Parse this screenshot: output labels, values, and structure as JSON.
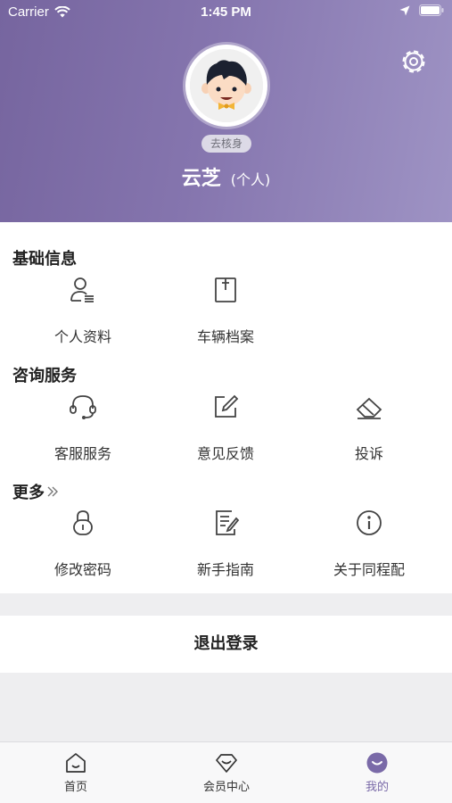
{
  "status_bar": {
    "carrier": "Carrier",
    "time": "1:45 PM"
  },
  "profile": {
    "verify_badge": "去核身",
    "name": "云芝",
    "account_type": "(个人)"
  },
  "sections": {
    "basic": {
      "title": "基础信息",
      "items": [
        {
          "label": "个人资料",
          "icon": "user-profile-icon"
        },
        {
          "label": "车辆档案",
          "icon": "vehicle-file-icon"
        }
      ]
    },
    "consult": {
      "title": "咨询服务",
      "items": [
        {
          "label": "客服服务",
          "icon": "headset-icon"
        },
        {
          "label": "意见反馈",
          "icon": "edit-icon"
        },
        {
          "label": "投诉",
          "icon": "eraser-icon"
        }
      ]
    },
    "more": {
      "title": "更多",
      "items": [
        {
          "label": "修改密码",
          "icon": "lock-icon"
        },
        {
          "label": "新手指南",
          "icon": "guide-doc-icon"
        },
        {
          "label": "关于同程配",
          "icon": "info-icon"
        }
      ]
    }
  },
  "logout_label": "退出登录",
  "tabs": [
    {
      "label": "首页",
      "icon": "home-icon"
    },
    {
      "label": "会员中心",
      "icon": "diamond-icon"
    },
    {
      "label": "我的",
      "icon": "smile-icon",
      "active": true
    }
  ],
  "colors": {
    "accent": "#7a6aa8",
    "header_start": "#76659f",
    "header_end": "#9e93c4"
  }
}
